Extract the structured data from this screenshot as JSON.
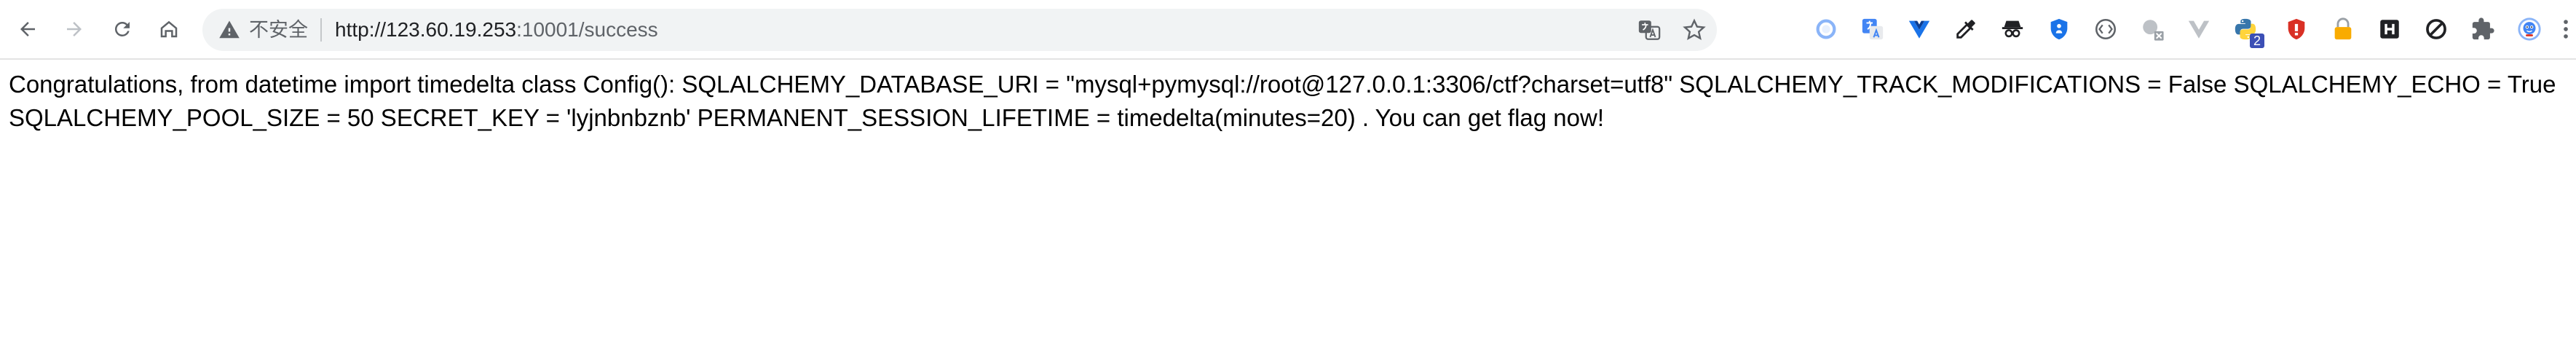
{
  "address_bar": {
    "security_label": "不安全",
    "url_host": "http://123.60.19.253",
    "url_rest": ":10001/success"
  },
  "extensions": {
    "badge_count": "2"
  },
  "page": {
    "message_line1": "Congratulations, from datetime import timedelta class Config(): SQLALCHEMY_DATABASE_URI = \"mysql+pymysql://root@127.0.0.1:3306/ctf?charset=utf8\" SQLALCHEMY_TRACK_MODIFICATIONS = False SQLALCHEMY_ECHO = True",
    "message_line2": "SQLALCHEMY_POOL_SIZE = 50 SECRET_KEY = 'lyjnbnbznb' PERMANENT_SESSION_LIFETIME = timedelta(minutes=20) . You can get flag now!"
  }
}
